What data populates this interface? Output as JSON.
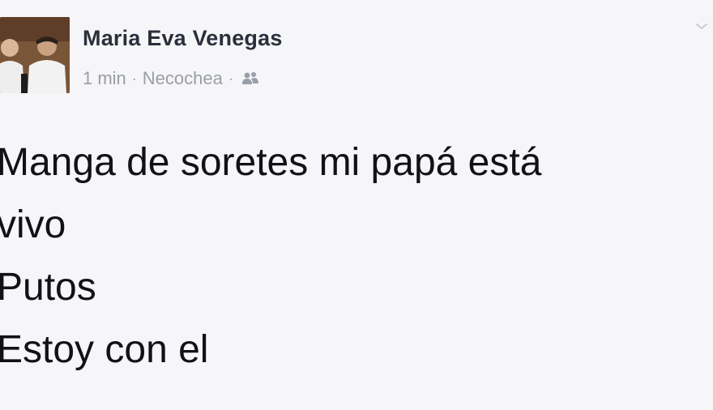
{
  "post": {
    "author": "Maria Eva Venegas",
    "time": "1 min",
    "separator": "·",
    "location": "Necochea",
    "audience_icon": "friends-icon",
    "lines": [
      "Manga de soretes mi papá está",
      "vivo",
      "Putos",
      "Estoy con el"
    ]
  },
  "colors": {
    "background": "#f6f6f8",
    "author_text": "#2b2f3a",
    "meta_text": "#9a9ea6",
    "body_text": "#111216"
  }
}
